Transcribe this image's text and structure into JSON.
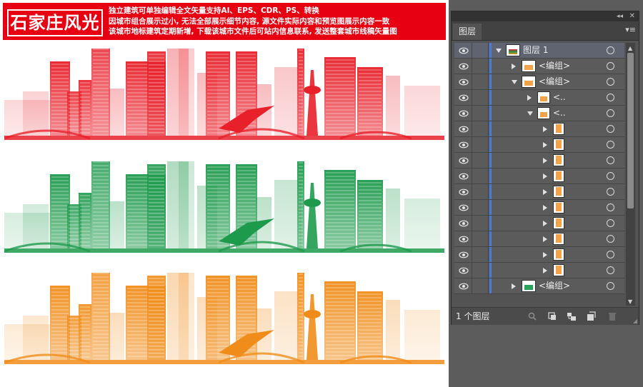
{
  "artboard": {
    "title": "石家庄风光",
    "lines": [
      "独立建筑可单独编辑全文矢量支持AI、EPS、CDR、PS、转换",
      "因城市组合展示过小, 无法全部展示细节内容, 源文件实际内容和预览图展示内容一致",
      "该城市地标建筑定期新增, 下载该城市文件后可站内信息联系, 发送整套城市线稿矢量图"
    ],
    "skylines": [
      {
        "name": "red",
        "color": "#e8202a"
      },
      {
        "name": "green",
        "color": "#1e9a4c"
      },
      {
        "name": "orange",
        "color": "#f08d1a"
      }
    ]
  },
  "panel": {
    "tab": "图层",
    "collapse_glyph": "◂◂",
    "close_glyph": "✕",
    "menu_glyph": "▾≡",
    "rows": [
      {
        "label": "图层 1",
        "depth": 0,
        "state": "down",
        "thumb": "layer"
      },
      {
        "label": "<编组>",
        "depth": 1,
        "state": "right",
        "thumb": "group"
      },
      {
        "label": "<编组>",
        "depth": 1,
        "state": "down",
        "thumb": "group"
      },
      {
        "label": "<..",
        "depth": 2,
        "state": "right",
        "thumb": "small"
      },
      {
        "label": "<..",
        "depth": 2,
        "state": "down",
        "thumb": "small"
      },
      {
        "label": "",
        "depth": 3,
        "state": "right",
        "thumb": "bldg"
      },
      {
        "label": "",
        "depth": 3,
        "state": "right",
        "thumb": "bldg"
      },
      {
        "label": "",
        "depth": 3,
        "state": "right",
        "thumb": "bldg"
      },
      {
        "label": "",
        "depth": 3,
        "state": "right",
        "thumb": "bldg"
      },
      {
        "label": "",
        "depth": 3,
        "state": "right",
        "thumb": "bldg"
      },
      {
        "label": "",
        "depth": 3,
        "state": "right",
        "thumb": "bldg"
      },
      {
        "label": "",
        "depth": 3,
        "state": "right",
        "thumb": "bldg"
      },
      {
        "label": "",
        "depth": 3,
        "state": "right",
        "thumb": "bldg"
      },
      {
        "label": "",
        "depth": 3,
        "state": "right",
        "thumb": "bldg"
      },
      {
        "label": "",
        "depth": 3,
        "state": "right",
        "thumb": "bldg"
      },
      {
        "label": "<编组>",
        "depth": 1,
        "state": "right",
        "thumb": "green"
      }
    ],
    "footer_label": "1 个图层",
    "footer_icons": [
      "search-icon",
      "make-clipping-mask-icon",
      "new-sublayer-icon",
      "new-layer-icon",
      "delete-icon"
    ]
  }
}
